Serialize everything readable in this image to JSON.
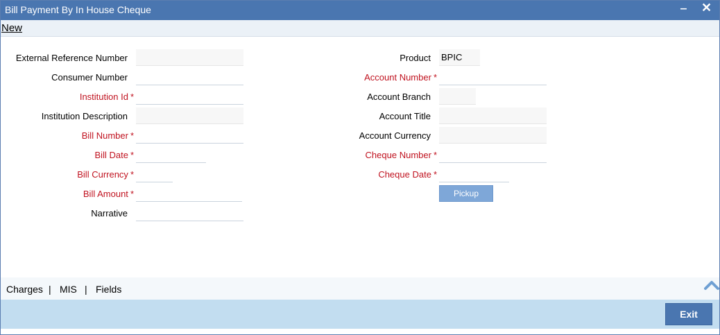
{
  "window": {
    "title": "Bill Payment By In House Cheque",
    "minimize_label": "‒",
    "close_label": "✕"
  },
  "toolbar": {
    "new_label": "New"
  },
  "form": {
    "left": [
      {
        "label": "External Reference Number",
        "required": false,
        "value": "",
        "readonly": true
      },
      {
        "label": "Consumer Number",
        "required": false,
        "value": "",
        "readonly": false
      },
      {
        "label": "Institution Id",
        "required": true,
        "value": "",
        "readonly": false
      },
      {
        "label": "Institution Description",
        "required": false,
        "value": "",
        "readonly": true
      },
      {
        "label": "Bill Number",
        "required": true,
        "value": "",
        "readonly": false
      },
      {
        "label": "Bill Date",
        "required": true,
        "value": "",
        "readonly": false
      },
      {
        "label": "Bill Currency",
        "required": true,
        "value": "",
        "readonly": false
      },
      {
        "label": "Bill Amount",
        "required": true,
        "value": "",
        "readonly": false
      },
      {
        "label": "Narrative",
        "required": false,
        "value": "",
        "readonly": false
      }
    ],
    "right": [
      {
        "label": "Product",
        "required": false,
        "value": "BPIC",
        "readonly": true
      },
      {
        "label": "Account Number",
        "required": true,
        "value": "",
        "readonly": false
      },
      {
        "label": "Account Branch",
        "required": false,
        "value": "",
        "readonly": true
      },
      {
        "label": "Account Title",
        "required": false,
        "value": "",
        "readonly": true
      },
      {
        "label": "Account Currency",
        "required": false,
        "value": "",
        "readonly": true
      },
      {
        "label": "Cheque Number",
        "required": true,
        "value": "",
        "readonly": false
      },
      {
        "label": "Cheque Date",
        "required": true,
        "value": "",
        "readonly": false
      }
    ],
    "required_marker": "*",
    "pickup_label": "Pickup"
  },
  "footer_tabs": {
    "items": [
      "Charges",
      "MIS",
      "Fields"
    ],
    "separator": "|"
  },
  "footer": {
    "exit_label": "Exit"
  },
  "colors": {
    "titlebar": "#4a76b0",
    "required_label": "#c0121f",
    "footer_bar": "#c2ddf0"
  }
}
